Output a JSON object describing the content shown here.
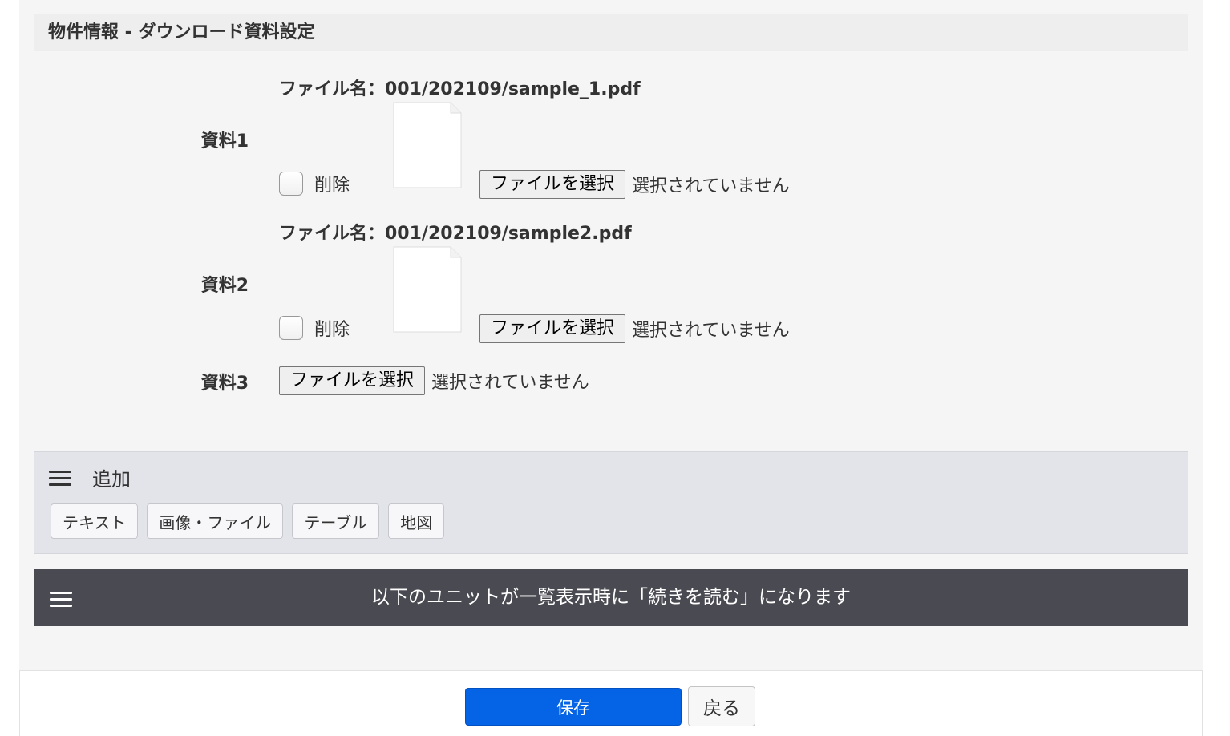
{
  "section": {
    "title": "物件情報 - ダウンロード資料設定"
  },
  "attachments": [
    {
      "label": "資料1",
      "filename": "ファイル名：001/202109/sample_1.pdf",
      "delete_label": "削除",
      "choose_button": "ファイルを選択",
      "status": "選択されていません",
      "thumbnail_icon": "blank-document-icon"
    },
    {
      "label": "資料2",
      "filename": "ファイル名：001/202109/sample2.pdf",
      "delete_label": "削除",
      "choose_button": "ファイルを選択",
      "status": "選択されていません",
      "thumbnail_icon": "blank-document-icon"
    },
    {
      "label": "資料3",
      "choose_button": "ファイルを選択",
      "status": "選択されていません"
    }
  ],
  "add_panel": {
    "icon": "hamburger-menu-icon",
    "title": "追加",
    "buttons": [
      "テキスト",
      "画像・ファイル",
      "テーブル",
      "地図"
    ]
  },
  "notice_bar": {
    "icon": "hamburger-menu-icon",
    "text": "以下のユニットが一覧表示時に「続きを読む」になります"
  },
  "footer": {
    "save_label": "保存",
    "back_label": "戻る"
  },
  "colors": {
    "page_background": "#f5f5f5",
    "primary_button": "#0563e6",
    "notice_bar": "#4a4a52",
    "add_panel": "#e3e4e9"
  }
}
